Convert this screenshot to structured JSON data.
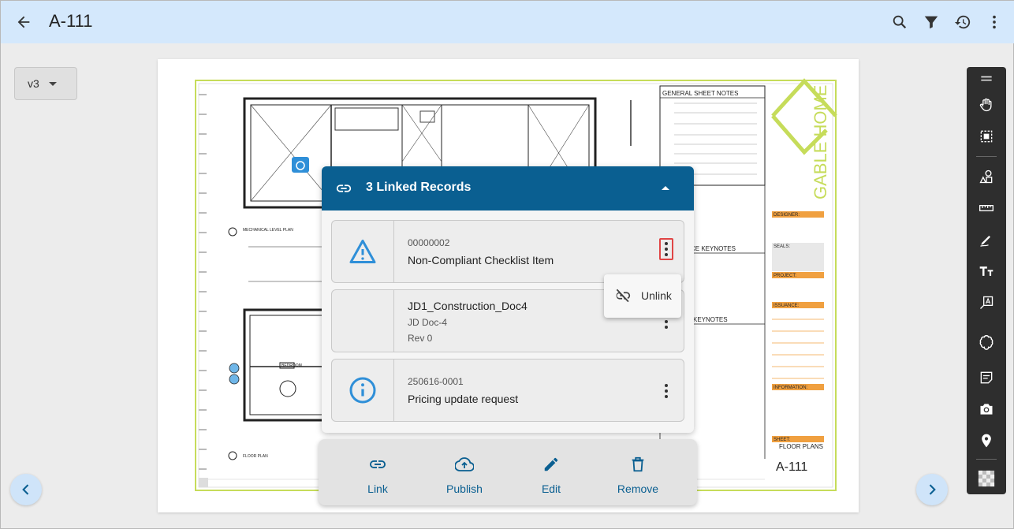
{
  "header": {
    "title": "A-111"
  },
  "version": {
    "selected": "v3"
  },
  "sheet": {
    "notes_title": "GENERAL SHEET NOTES",
    "brand": "GABLE HOME",
    "keynotes_a": "CE KEYNOTES",
    "keynotes_b": "KEYNOTES",
    "designer_label": "DESIGNER:",
    "seals_label": "SEALS:",
    "project_label": "PROJECT:",
    "issuance_label": "ISSUANCE:",
    "information_label": "INFORMATION:",
    "sheet_label": "SHEET:",
    "sheet_name": "FLOOR PLANS",
    "sheet_number": "A-111",
    "plan_label_top": "MECHANICAL LEVEL PLAN",
    "plan_label_bottom": "FLOOR PLAN",
    "room_label": "BEDROOM"
  },
  "panel": {
    "title": "3 Linked Records",
    "records": [
      {
        "line1": "00000002",
        "line2": "Non-Compliant Checklist Item",
        "icon": "warning-icon"
      },
      {
        "line1": "JD1_Construction_Doc4",
        "line2": "JD Doc-4",
        "line3": "Rev 0",
        "icon": "document-icon"
      },
      {
        "line1": "250616-0001",
        "line2": "Pricing update request",
        "icon": "info-icon"
      }
    ]
  },
  "menu": {
    "unlink_label": "Unlink"
  },
  "actions": {
    "link": "Link",
    "publish": "Publish",
    "edit": "Edit",
    "remove": "Remove"
  },
  "colors": {
    "header_bg": "#d4e8fc",
    "panel_header": "#0a5f91",
    "accent_blue": "#2f8fd8",
    "sheet_green": "#c6dc5a",
    "sheet_orange": "#f0a040",
    "highlight_red": "#e04545"
  }
}
